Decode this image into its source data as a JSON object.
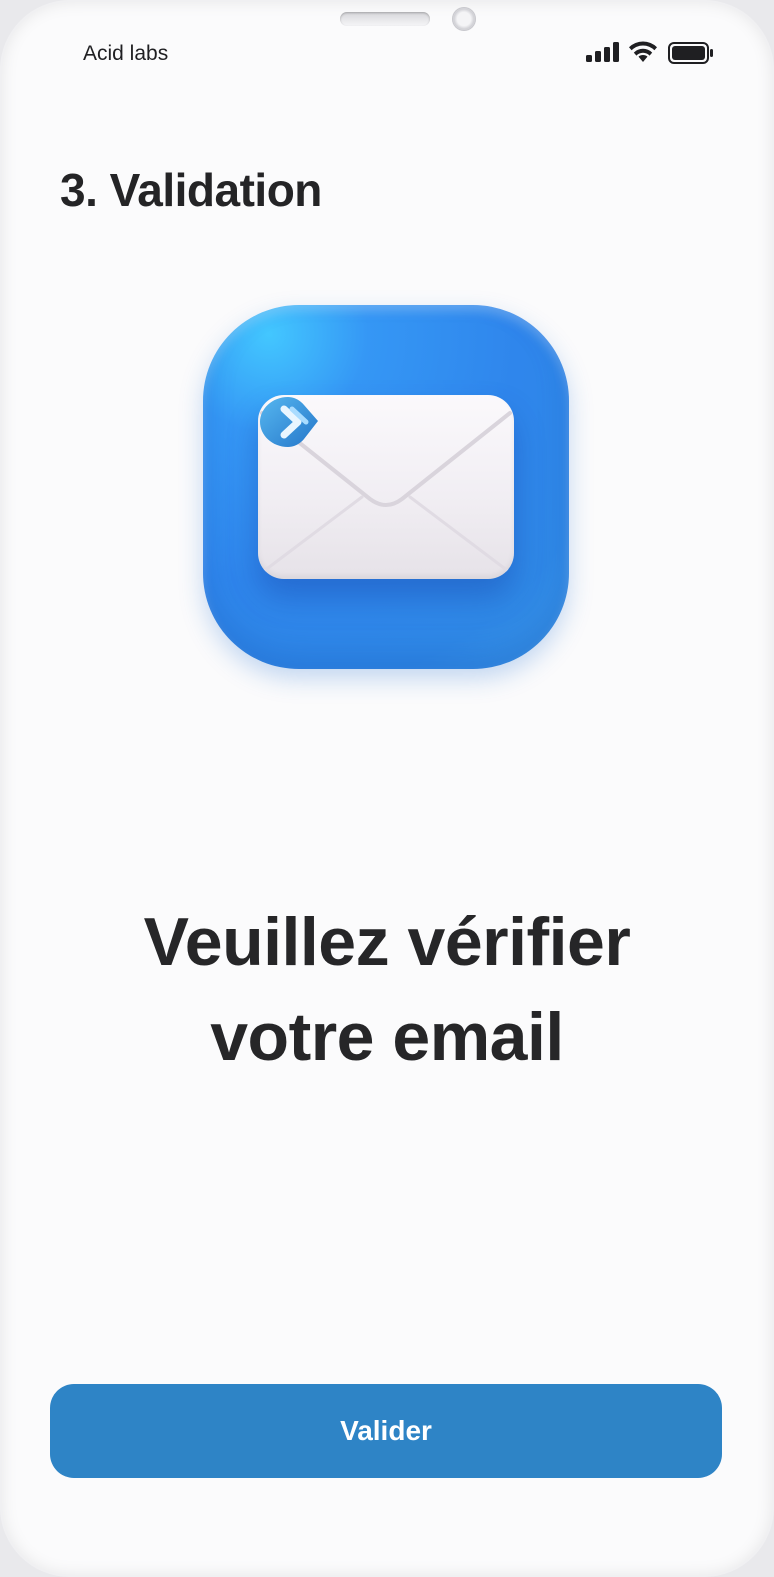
{
  "status_bar": {
    "carrier": "Acid labs",
    "icons": [
      "cellular-signal-icon",
      "wifi-icon",
      "battery-icon"
    ]
  },
  "page": {
    "title": "3. Validation",
    "illustration": "mail-envelope-icon",
    "message_line_1": "Veuillez vérifier",
    "message_line_2": "votre email"
  },
  "actions": {
    "validate_label": "Valider"
  },
  "colors": {
    "background": "#fbfbfc",
    "primary_button": "#2e84c6",
    "icon_blue": "#2f86ec",
    "text": "#262628"
  }
}
